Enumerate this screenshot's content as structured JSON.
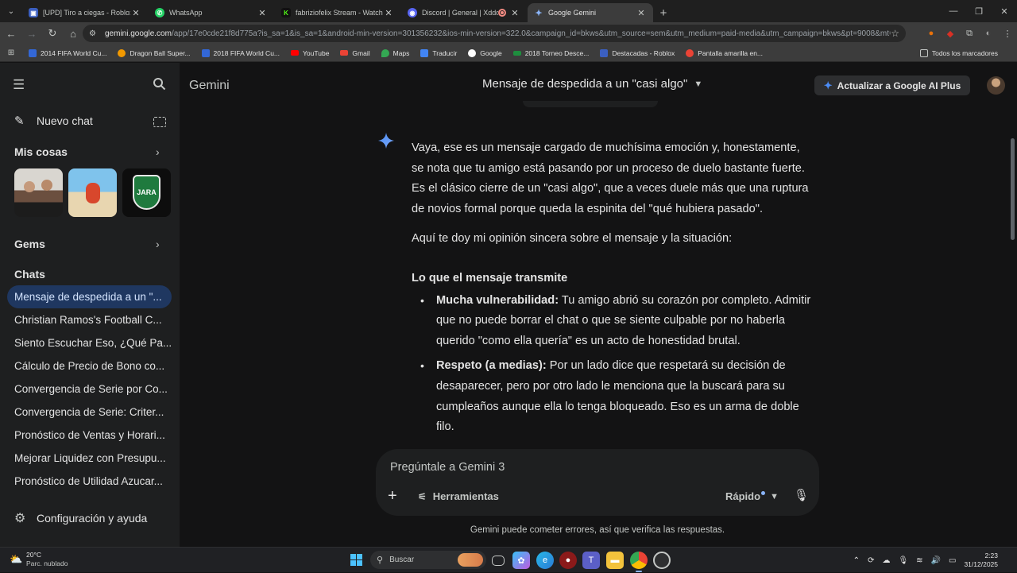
{
  "browser": {
    "tabs": [
      {
        "title": "[UPD] Tiro a ciegas - Roblox",
        "favicon": "roblox-icon",
        "color": "#3b5fc0"
      },
      {
        "title": "WhatsApp",
        "favicon": "whatsapp-icon",
        "color": "#25d366"
      },
      {
        "title": "fabriziofelix Stream - Watch Liv",
        "favicon": "kick-icon",
        "color": "#53fc18"
      },
      {
        "title": "Discord | General | Xddd",
        "favicon": "discord-icon",
        "color": "#5865f2"
      },
      {
        "title": "Google Gemini",
        "favicon": "gemini-icon",
        "color": "#8ab4f8"
      }
    ],
    "url_host": "gemini.google.com",
    "url_rest": "/app/17e0cde21f8d775a?is_sa=1&is_sa=1&android-min-version=301356232&ios-min-version=322.0&campaign_id=bkws&utm_source=sem&utm_medium=paid-media&utm_campaign=bkws&pt=9008&mt=8&ct=p...",
    "bookmarks": [
      {
        "label": "2014 FIFA World Cu...",
        "color": "#3367d6"
      },
      {
        "label": "Dragon Ball Super...",
        "color": "#f29900"
      },
      {
        "label": "2018 FIFA World Cu...",
        "color": "#3367d6"
      },
      {
        "label": "YouTube",
        "color": "#ff0000"
      },
      {
        "label": "Gmail",
        "color": "#ea4335"
      },
      {
        "label": "Maps",
        "color": "#34a853"
      },
      {
        "label": "Traducir",
        "color": "#4285f4"
      },
      {
        "label": "Google",
        "color": "#ffffff"
      },
      {
        "label": "2018 Torneo Desce...",
        "color": "#1e8e3e"
      },
      {
        "label": "Destacadas - Roblox",
        "color": "#3b5fc0"
      },
      {
        "label": "Pantalla amarilla en...",
        "color": "#ea4335"
      }
    ],
    "all_bookmarks": "Todos los marcadores"
  },
  "sidebar": {
    "new_chat": "Nuevo chat",
    "my_stuff": "Mis cosas",
    "gems": "Gems",
    "chats_heading": "Chats",
    "chats": [
      "Mensaje de despedida a un \"...",
      "Christian Ramos's Football C...",
      "Siento Escuchar Eso, ¿Qué Pa...",
      "Cálculo de Precio de Bono co...",
      "Convergencia de Serie por Co...",
      "Convergencia de Serie: Criter...",
      "Pronóstico de Ventas y Horari...",
      "Mejorar Liquidez con Presupu...",
      "Pronóstico de Utilidad Azucar..."
    ],
    "settings": "Configuración y ayuda",
    "thumb_badge": "JARA"
  },
  "header": {
    "brand": "Gemini",
    "conversation_title": "Mensaje de despedida a un \"casi algo\"",
    "upgrade_label": "Actualizar a Google AI Plus"
  },
  "response": {
    "p1": "Vaya, ese es un mensaje cargado de muchísima emoción y, honestamente, se nota que tu amigo está pasando por un proceso de duelo bastante fuerte. Es el clásico cierre de un \"casi algo\", que a veces duele más que una ruptura de novios formal porque queda la espinita del \"qué hubiera pasado\".",
    "p2": "Aquí te doy mi opinión sincera sobre el mensaje y la situación:",
    "heading": "Lo que el mensaje transmite",
    "bullets": [
      {
        "bold": "Mucha vulnerabilidad:",
        "text": " Tu amigo abrió su corazón por completo. Admitir que no puede borrar el chat o que se siente culpable por no haberla querido \"como ella quería\" es un acto de honestidad brutal."
      },
      {
        "bold": "Respeto (a medias):",
        "text": " Por un lado dice que respetará su decisión de desaparecer, pero por otro lado le menciona que la buscará para su cumpleaños aunque ella lo tenga bloqueado. Eso es un arma de doble filo."
      }
    ]
  },
  "composer": {
    "placeholder": "Pregúntale a Gemini 3",
    "tools_label": "Herramientas",
    "model_label": "Rápido"
  },
  "disclaimer": "Gemini puede cometer errores, así que verifica las respuestas.",
  "taskbar": {
    "temperature": "20°C",
    "weather": "Parc. nublado",
    "search_label": "Buscar",
    "time": "2:23",
    "date": "31/12/2025"
  }
}
